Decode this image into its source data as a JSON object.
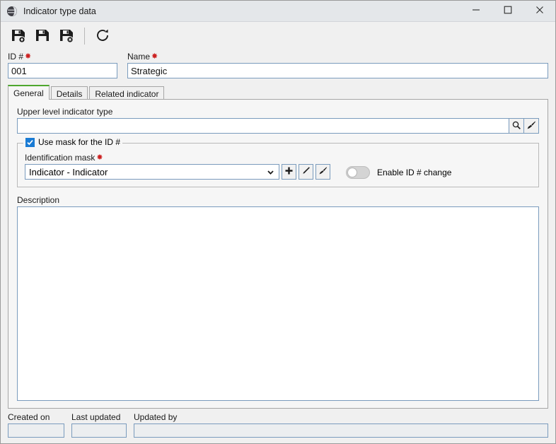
{
  "window": {
    "title": "Indicator type data",
    "app_icon": "globe-icon",
    "controls": {
      "minimize": "minimize-icon",
      "maximize": "maximize-icon",
      "close": "close-icon"
    }
  },
  "toolbar": {
    "buttons": [
      {
        "name": "save-and-new-button",
        "icon": "save-new-icon",
        "tooltip": "Save and create new"
      },
      {
        "name": "save-button",
        "icon": "save-icon",
        "tooltip": "Save"
      },
      {
        "name": "save-and-close-button",
        "icon": "save-close-icon",
        "tooltip": "Save and close"
      },
      {
        "name": "refresh-button",
        "icon": "refresh-icon",
        "tooltip": "Refresh"
      }
    ]
  },
  "fields": {
    "id": {
      "label": "ID #",
      "required_marker": "✸",
      "value": "001",
      "placeholder": ""
    },
    "name": {
      "label": "Name",
      "required_marker": "✸",
      "value": "Strategic",
      "placeholder": ""
    }
  },
  "tabs": [
    {
      "label": "General",
      "active": true
    },
    {
      "label": "Details",
      "active": false
    },
    {
      "label": "Related indicator",
      "active": false
    }
  ],
  "general": {
    "upper_level": {
      "label": "Upper level indicator type",
      "value": "",
      "placeholder": "",
      "search_button": "search-icon",
      "clear_button": "brush-icon"
    },
    "mask_group": {
      "legend": "Use mask for the ID #",
      "checked": true,
      "mask_field": {
        "label": "Identification mask",
        "required_marker": "✸",
        "selected": "Indicator - Indicator",
        "options": [
          "Indicator - Indicator"
        ],
        "add_button": "plus-icon",
        "edit_button": "pencil-icon",
        "clear_button": "brush-icon"
      },
      "toggle": {
        "label": "Enable ID # change",
        "enabled": false
      }
    },
    "description": {
      "label": "Description",
      "value": "",
      "placeholder": ""
    }
  },
  "footer": {
    "created_on": {
      "label": "Created on",
      "value": ""
    },
    "last_updated": {
      "label": "Last updated",
      "value": ""
    },
    "updated_by": {
      "label": "Updated by",
      "value": ""
    }
  },
  "colors": {
    "titlebar": "#e4e7ea",
    "window_bg": "#f0f0f0",
    "panel_bg": "#f6f6f6",
    "field_border": "#7a9bbd",
    "active_tab_accent": "#4ea72e",
    "checkbox_blue": "#1a7bd4",
    "required_red": "#cc2222",
    "disabled_field": "#eceef0"
  }
}
